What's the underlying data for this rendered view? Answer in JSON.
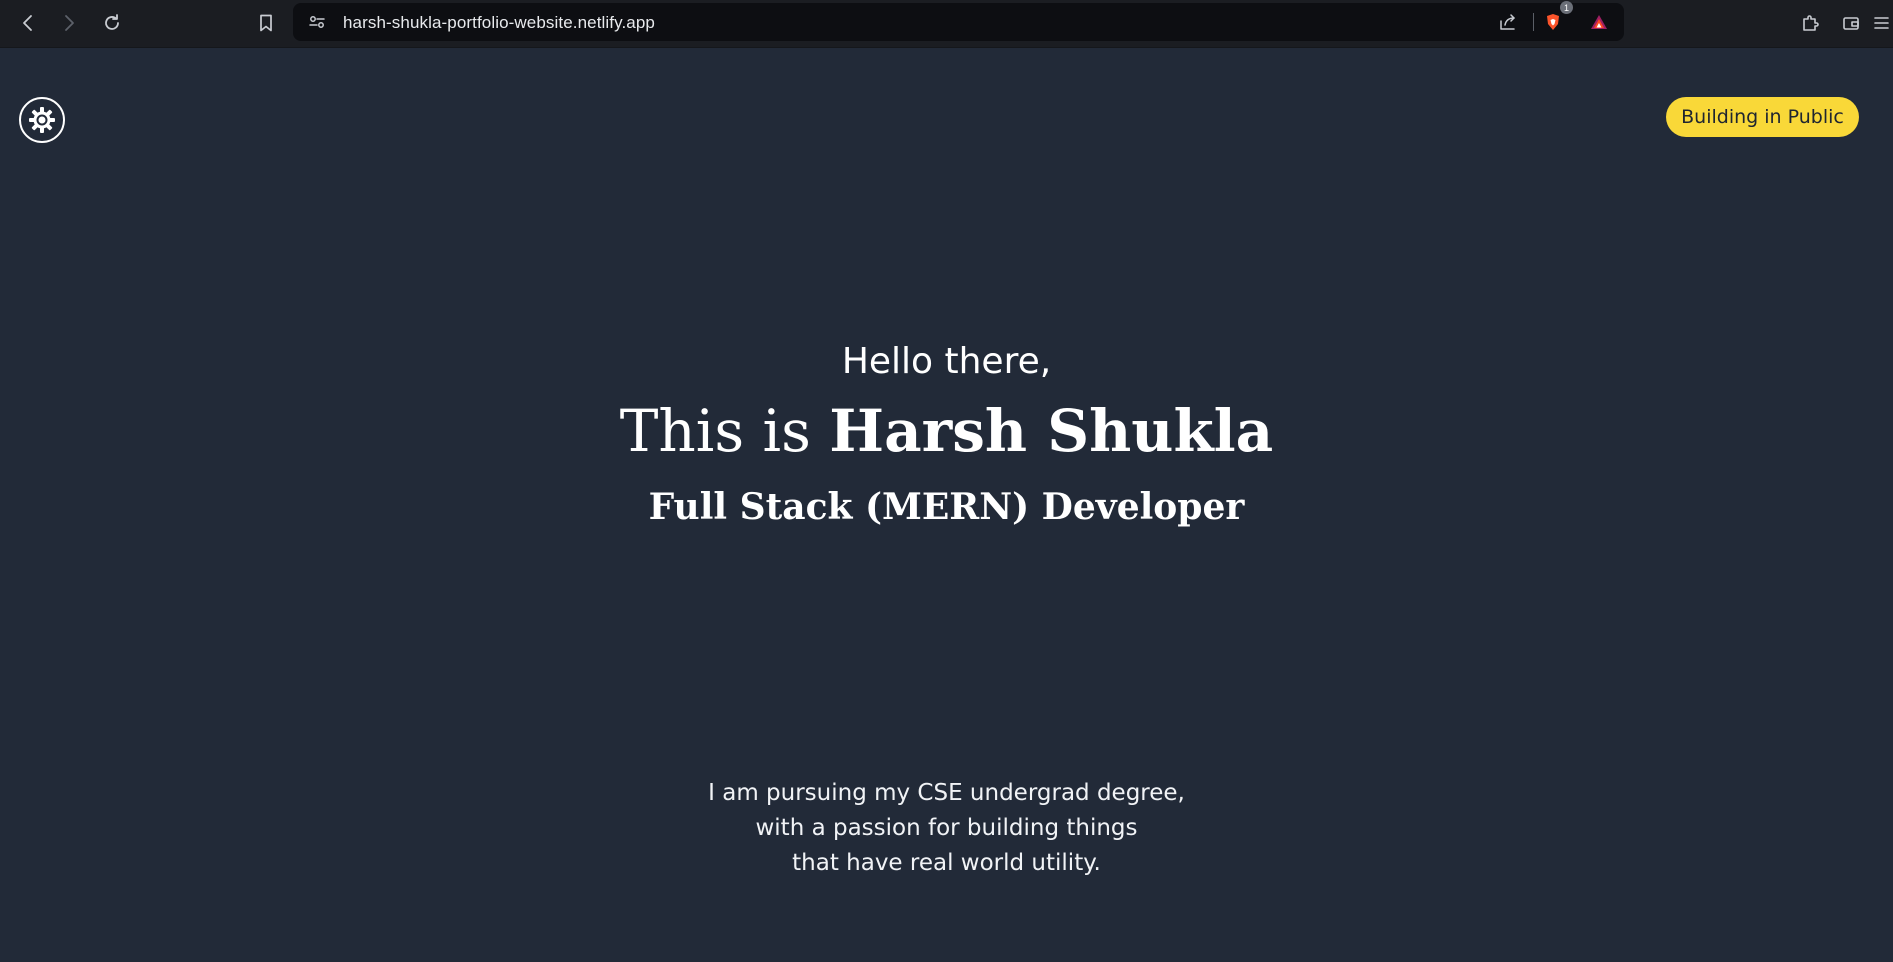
{
  "browser": {
    "url": "harsh-shukla-portfolio-website.netlify.app",
    "brave_shield_count": "1",
    "icons": [
      "back-icon",
      "forward-icon",
      "reload-icon",
      "bookmark-icon",
      "site-settings-icon",
      "share-icon",
      "brave-shields-icon",
      "brave-rewards-icon",
      "extensions-icon",
      "wallet-icon",
      "menu-icon"
    ]
  },
  "header": {
    "theme_toggle_icon": "gear-sun-icon",
    "cta_label": "Building in Public"
  },
  "hero": {
    "greeting": "Hello there,",
    "intro_prefix": "This is",
    "name": "Harsh Shukla",
    "role": "Full Stack (MERN) Developer"
  },
  "bio": {
    "lines": [
      "I am pursuing my CSE undergrad degree,",
      "with a passion for building things",
      "that have real world utility."
    ]
  },
  "colors": {
    "page_background": "#222a38",
    "accent_yellow": "#f9d838",
    "text": "#ffffff"
  }
}
